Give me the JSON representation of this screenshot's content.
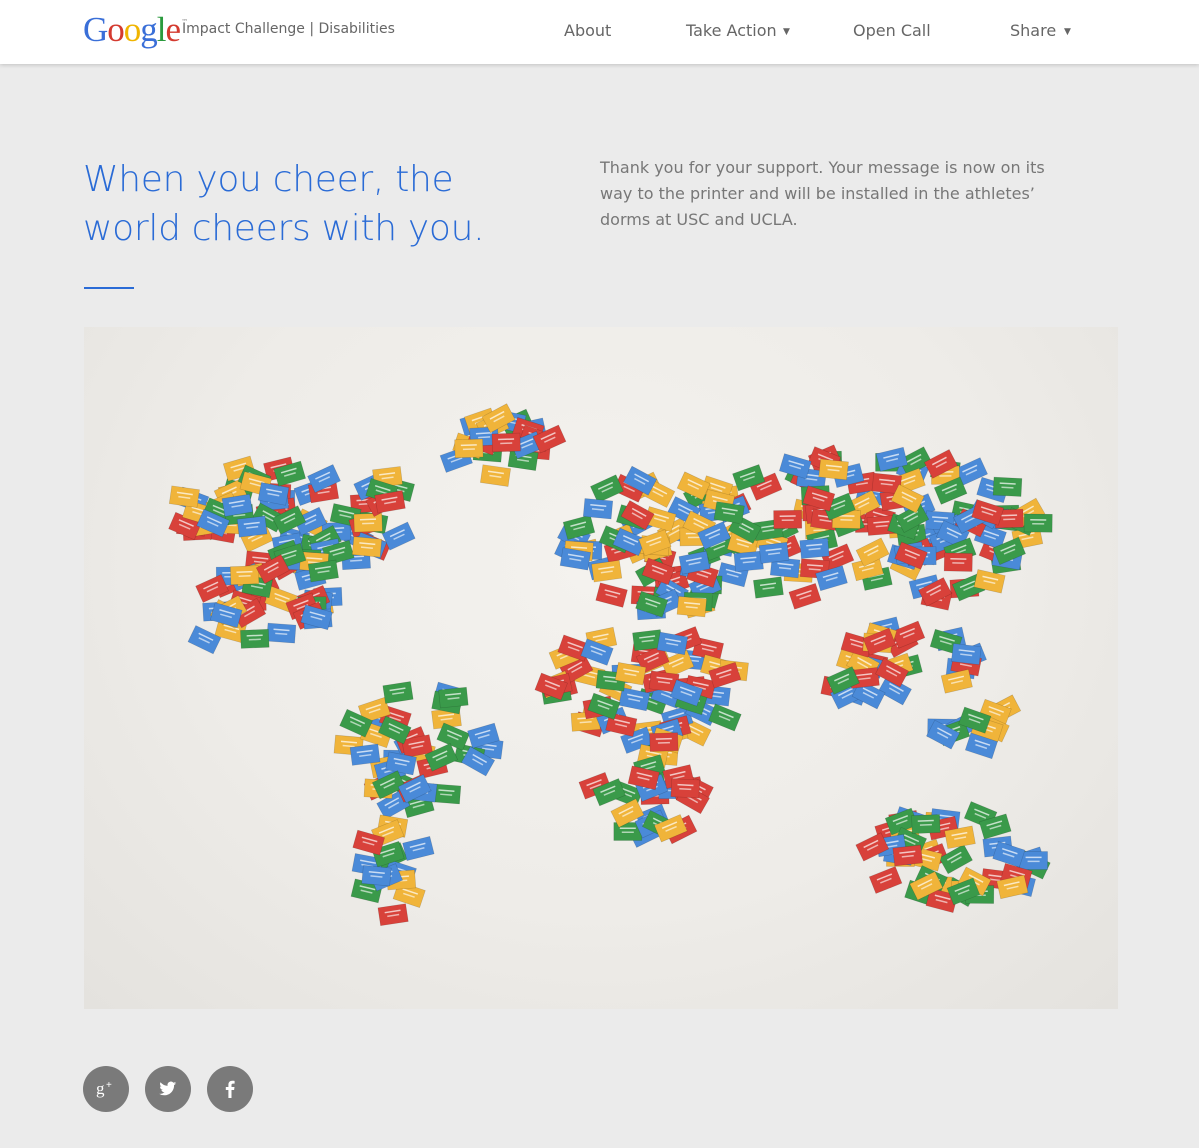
{
  "header": {
    "logo_letters": [
      "G",
      "o",
      "o",
      "g",
      "l",
      "e"
    ],
    "logo_tm": "™",
    "subtitle": "Impact Challenge | Disabilities",
    "nav": [
      {
        "label": "About",
        "has_dropdown": false
      },
      {
        "label": "Take Action",
        "has_dropdown": true
      },
      {
        "label": "Open Call",
        "has_dropdown": false
      },
      {
        "label": "Share",
        "has_dropdown": true
      }
    ],
    "dropdown_glyph": "▼"
  },
  "hero": {
    "headline": "When you cheer, the world cheers with you.",
    "message": "Thank you for your support. Your message is now on its way to the printer and will be installed in the athletes’ dorms at USC and UCLA."
  },
  "colors": {
    "accent_blue": "#2a6bd6",
    "card_blue": "#4a8ad8",
    "card_red": "#d8413a",
    "card_green": "#3a9a4a",
    "card_yellow": "#f0b43a",
    "social_gray": "#7a7a7a"
  },
  "map": {
    "description_icon": "world-map-of-cards"
  },
  "social": [
    {
      "name": "google-plus",
      "icon": "google-plus-icon"
    },
    {
      "name": "twitter",
      "icon": "twitter-icon"
    },
    {
      "name": "facebook",
      "icon": "facebook-icon"
    }
  ]
}
